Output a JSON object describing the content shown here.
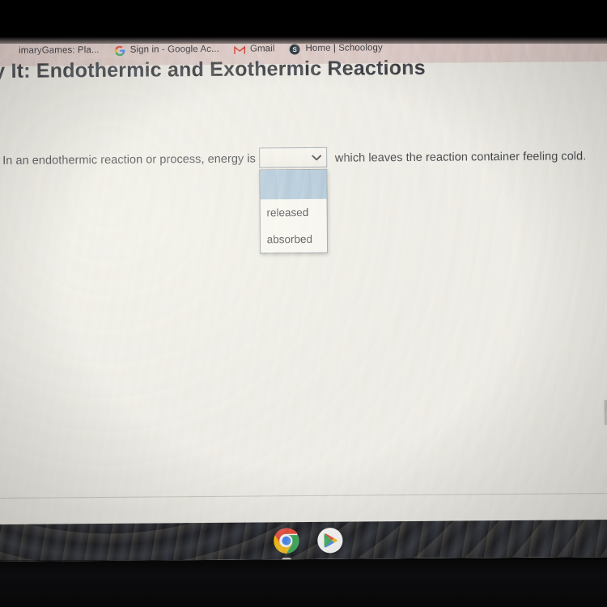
{
  "browser": {
    "bookmarks": [
      {
        "label": "imaryGames: Pla...",
        "icon": "primarygames-icon"
      },
      {
        "label": "Sign in - Google Ac...",
        "icon": "google-g-icon"
      },
      {
        "label": "Gmail",
        "icon": "gmail-icon"
      },
      {
        "label": "Home | Schoology",
        "icon": "schoology-icon"
      }
    ]
  },
  "page": {
    "title": "ry It: Endothermic and Exothermic Reactions",
    "question": {
      "lead": "In an endothermic reaction or process, energy is",
      "tail": "which leaves the reaction container feeling cold."
    },
    "select": {
      "value": "",
      "chevron": "chevron-down-icon",
      "options": [
        {
          "label": "",
          "highlighted": true
        },
        {
          "label": "released",
          "highlighted": false
        },
        {
          "label": "absorbed",
          "highlighted": false
        }
      ]
    }
  },
  "shelf": {
    "icons": [
      {
        "name": "chrome-icon",
        "active": true
      },
      {
        "name": "play-store-icon",
        "active": false
      }
    ]
  },
  "colors": {
    "highlight": "#a9c1d4",
    "bookmark_bar": "#e2cdc9",
    "page_bg": "#eceae3",
    "shelf_bg": "#1b1b20"
  }
}
